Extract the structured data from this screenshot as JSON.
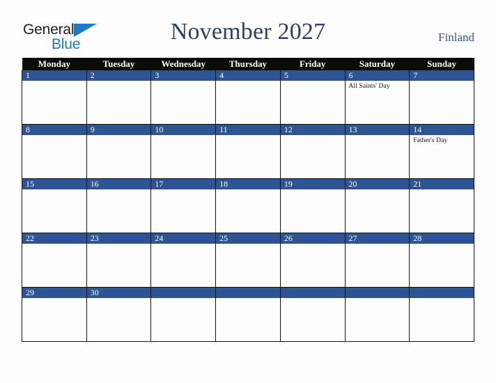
{
  "brand": {
    "line1": "General",
    "line2": "Blue",
    "triangle_color": "#1f7bc1",
    "text_color": "#231f20"
  },
  "header": {
    "title": "November 2027",
    "country": "Finland",
    "title_color": "#2b4268"
  },
  "theme": {
    "header_bar_bg": "#0b0b0b",
    "day_band_bg": "#2e5496",
    "page_bg": "#fdfdfd",
    "grid_line": "#111111"
  },
  "weekdays": [
    "Monday",
    "Tuesday",
    "Wednesday",
    "Thursday",
    "Friday",
    "Saturday",
    "Sunday"
  ],
  "weeks": [
    [
      {
        "day": "1",
        "events": []
      },
      {
        "day": "2",
        "events": []
      },
      {
        "day": "3",
        "events": []
      },
      {
        "day": "4",
        "events": []
      },
      {
        "day": "5",
        "events": []
      },
      {
        "day": "6",
        "events": [
          "All Saints' Day"
        ]
      },
      {
        "day": "7",
        "events": []
      }
    ],
    [
      {
        "day": "8",
        "events": []
      },
      {
        "day": "9",
        "events": []
      },
      {
        "day": "10",
        "events": []
      },
      {
        "day": "11",
        "events": []
      },
      {
        "day": "12",
        "events": []
      },
      {
        "day": "13",
        "events": []
      },
      {
        "day": "14",
        "events": [
          "Father's Day"
        ]
      }
    ],
    [
      {
        "day": "15",
        "events": []
      },
      {
        "day": "16",
        "events": []
      },
      {
        "day": "17",
        "events": []
      },
      {
        "day": "18",
        "events": []
      },
      {
        "day": "19",
        "events": []
      },
      {
        "day": "20",
        "events": []
      },
      {
        "day": "21",
        "events": []
      }
    ],
    [
      {
        "day": "22",
        "events": []
      },
      {
        "day": "23",
        "events": []
      },
      {
        "day": "24",
        "events": []
      },
      {
        "day": "25",
        "events": []
      },
      {
        "day": "26",
        "events": []
      },
      {
        "day": "27",
        "events": []
      },
      {
        "day": "28",
        "events": []
      }
    ],
    [
      {
        "day": "29",
        "events": []
      },
      {
        "day": "30",
        "events": []
      },
      {
        "day": "",
        "events": []
      },
      {
        "day": "",
        "events": []
      },
      {
        "day": "",
        "events": []
      },
      {
        "day": "",
        "events": []
      },
      {
        "day": "",
        "events": []
      }
    ]
  ]
}
